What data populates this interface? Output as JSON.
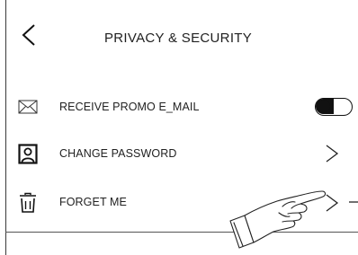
{
  "header": {
    "title": "PRIVACY & SECURITY",
    "back_icon": "chevron-left-icon"
  },
  "settings": {
    "items": [
      {
        "label": "RECEIVE PROMO E_MAIL",
        "icon": "envelope-icon",
        "control": "toggle",
        "toggle_on": false
      },
      {
        "label": "CHANGE PASSWORD",
        "icon": "user-icon",
        "control": "chevron",
        "chevron_icon": "chevron-right-icon"
      },
      {
        "label": "FORGET ME",
        "icon": "trash-icon",
        "control": "chevron",
        "chevron_icon": "chevron-right-icon"
      }
    ]
  },
  "overlay": {
    "icon": "pointing-hand-icon"
  },
  "colors": {
    "text": "#222222",
    "ink": "#111111",
    "background": "#ffffff"
  }
}
